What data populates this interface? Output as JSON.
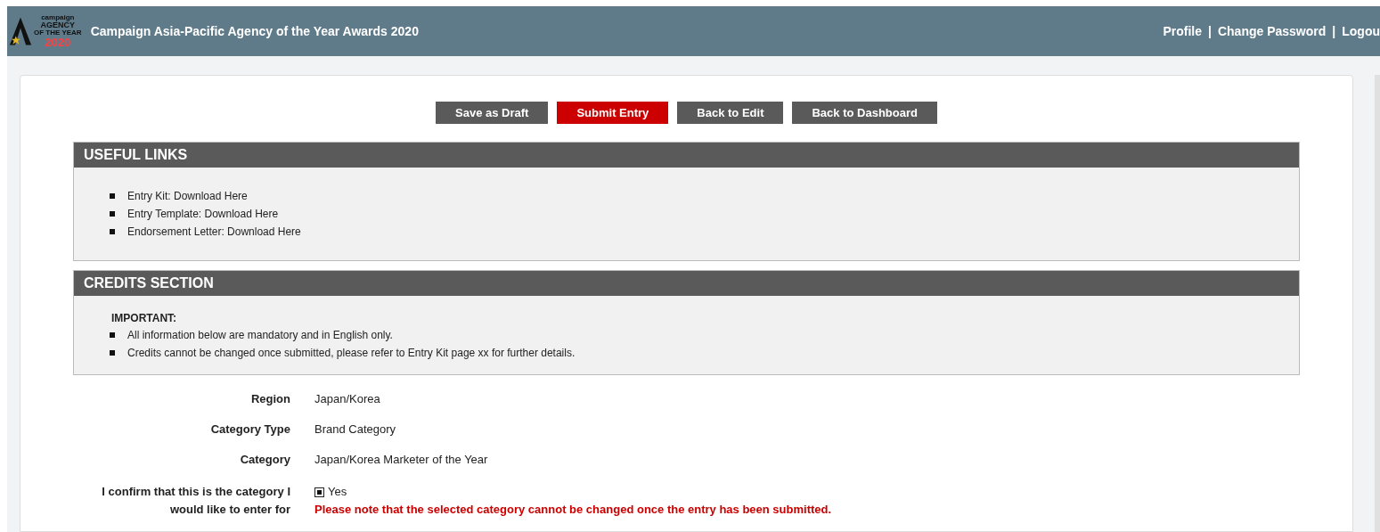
{
  "header": {
    "logo": {
      "lines": [
        "campaign",
        "AGENCY",
        "OF THE YEAR",
        "2020"
      ]
    },
    "title": "Campaign Asia-Pacific Agency of the Year Awards 2020",
    "links": [
      "Profile",
      "Change Password",
      "Logou"
    ],
    "separators": [
      "|",
      "|"
    ]
  },
  "actions": [
    {
      "label": "Save as Draft",
      "kind": "default"
    },
    {
      "label": "Submit Entry",
      "kind": "primary"
    },
    {
      "label": "Back to Edit",
      "kind": "default"
    },
    {
      "label": "Back to Dashboard",
      "kind": "default"
    }
  ],
  "useful_links": {
    "title": "USEFUL LINKS",
    "items": [
      "Entry Kit: Download Here",
      "Entry Template: Download Here",
      "Endorsement Letter: Download Here"
    ]
  },
  "credits": {
    "title": "CREDITS SECTION",
    "heading": "IMPORTANT:",
    "items": [
      "All information below are mandatory and in English only.",
      "Credits cannot be changed once submitted, please refer to Entry Kit page xx for further details."
    ]
  },
  "fields": [
    {
      "label": "Region",
      "value": "Japan/Korea"
    },
    {
      "label": "Category Type",
      "value": "Brand Category"
    },
    {
      "label": "Category",
      "value": "Japan/Korea Marketer of the Year"
    }
  ],
  "confirm": {
    "label": "I confirm that this is the category I would like to enter for",
    "option": "Yes",
    "checked": true,
    "warning": "Please note that the selected category cannot be changed once the entry has been submitted."
  }
}
